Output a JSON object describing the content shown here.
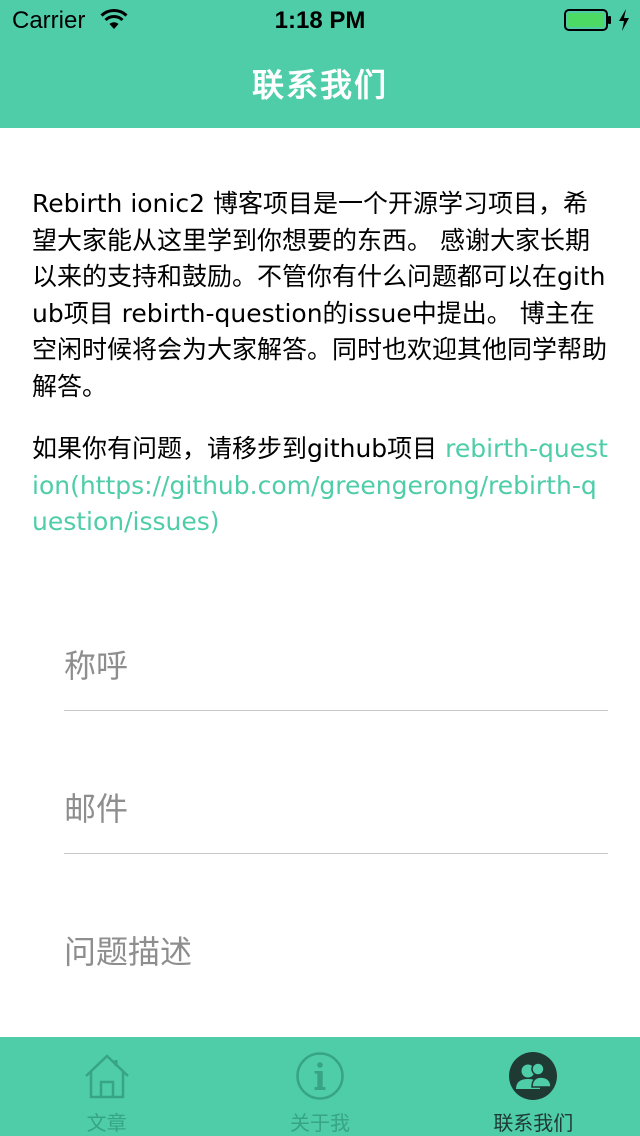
{
  "status_bar": {
    "carrier": "Carrier",
    "time": "1:18 PM"
  },
  "header": {
    "title": "联系我们"
  },
  "content": {
    "intro": "Rebirth ionic2 博客项目是一个开源学习项目，希望大家能从这里学到你想要的东西。 感谢大家长期以来的支持和鼓励。不管你有什么问题都可以在github项目 rebirth-question的issue中提出。 博主在空闲时候将会为大家解答。同时也欢迎其他同学帮助解答。",
    "question_prefix": "如果你有问题，请移步到github项目 ",
    "question_link": "rebirth-question(https://github.com/greengerong/rebirth-question/issues)"
  },
  "form": {
    "name_placeholder": "称呼",
    "email_placeholder": "邮件",
    "description_placeholder": "问题描述"
  },
  "tabs": [
    {
      "label": "文章",
      "icon": "home-icon",
      "active": false
    },
    {
      "label": "关于我",
      "icon": "info-icon",
      "active": false
    },
    {
      "label": "联系我们",
      "icon": "contacts-icon",
      "active": true
    }
  ],
  "colors": {
    "accent": "#4ecda8",
    "tab_inactive": "#37a486",
    "tab_active": "#1f3a33"
  }
}
